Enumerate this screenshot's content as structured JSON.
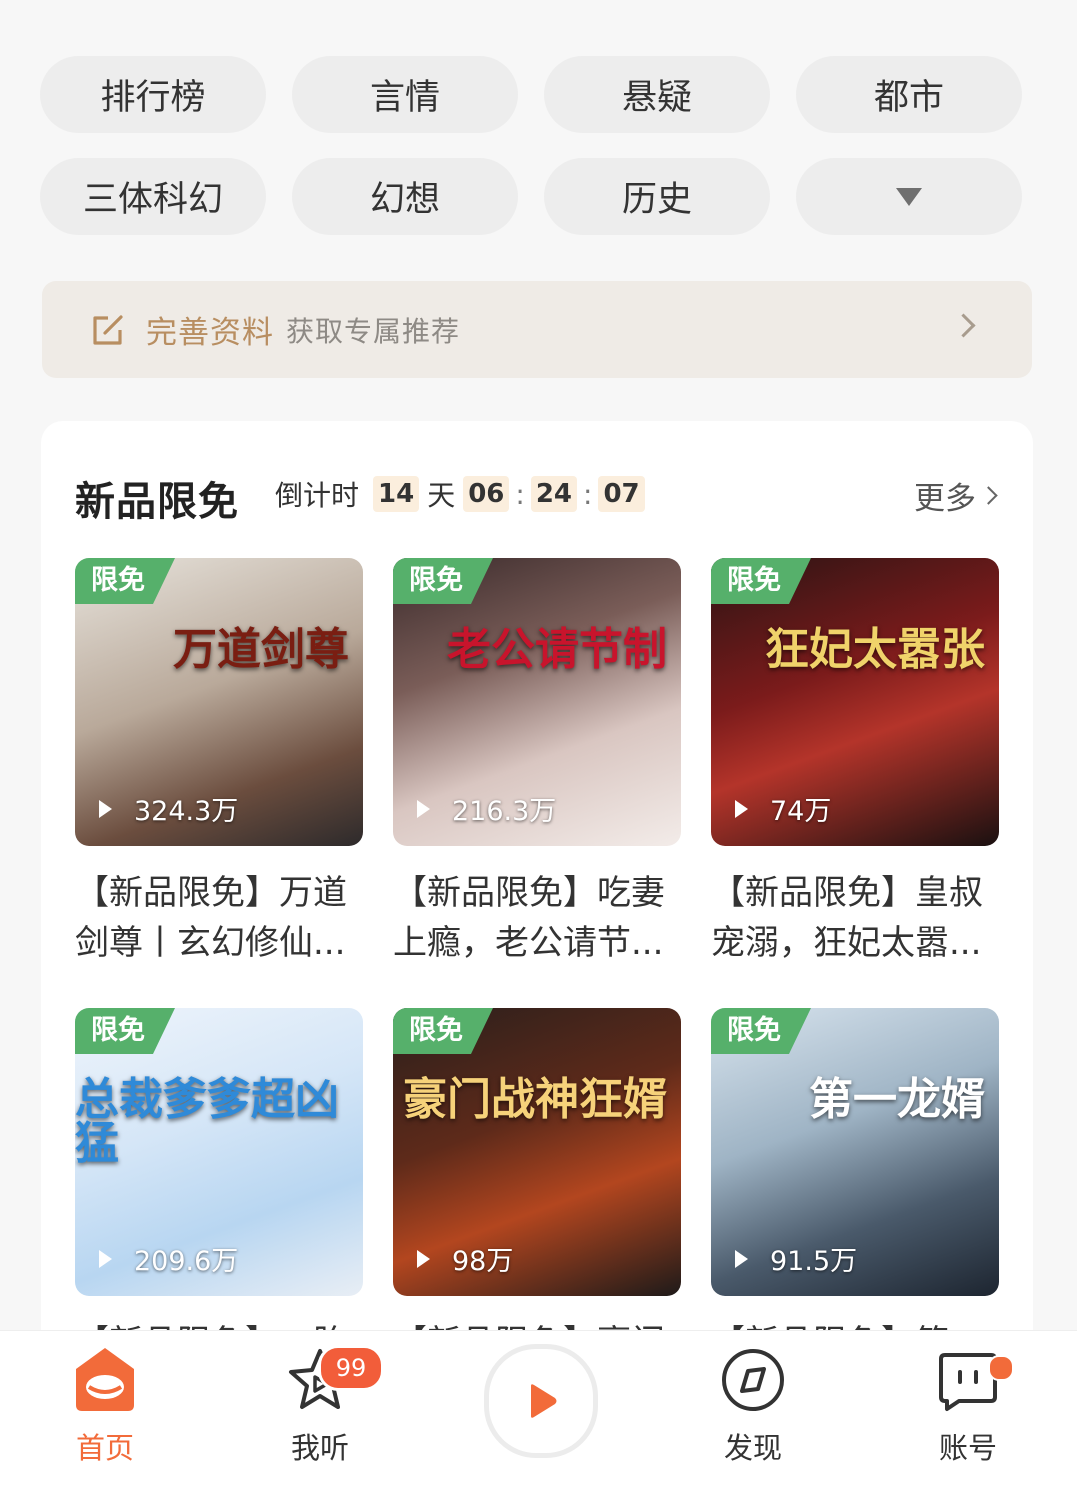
{
  "categories": [
    {
      "label": "排行榜"
    },
    {
      "label": "言情"
    },
    {
      "label": "悬疑"
    },
    {
      "label": "都市"
    },
    {
      "label": "三体科幻"
    },
    {
      "label": "幻想"
    },
    {
      "label": "历史"
    },
    {
      "label": ""
    }
  ],
  "profile_banner": {
    "icon": "edit-icon",
    "highlight": "完善资料",
    "text": "获取专属推荐",
    "icon_color": "#b88e61"
  },
  "section": {
    "title": "新品限免",
    "countdown": {
      "label": "倒计时",
      "days": "14",
      "day_unit": "天",
      "hours": "06",
      "minutes": "24",
      "seconds": "07"
    },
    "more_label": "更多"
  },
  "books": [
    {
      "tag": "限免",
      "plays": "324.3万",
      "cover_text": "万道剑尊",
      "line1": "【新品限免】万道",
      "line2": "剑尊丨玄幻修仙...",
      "bg": "linear-gradient(160deg,#e7e3dc 0%,#b9a99a 45%,#6b4d3e 75%,#2d2a2b 100%)",
      "text_color": "#7a1e12"
    },
    {
      "tag": "限免",
      "plays": "216.3万",
      "cover_text": "老公请节制",
      "line1": "【新品限免】吃妻",
      "line2": "上瘾，老公请节...",
      "bg": "linear-gradient(160deg,#3a2a2b 0%,#7a5d58 35%,#d9c6c1 65%,#f3ece9 100%)",
      "text_color": "#c8142c"
    },
    {
      "tag": "限免",
      "plays": "74万",
      "cover_text": "狂妃太嚣张",
      "line1": "【新品限免】皇叔",
      "line2": "宠溺，狂妃太嚣...",
      "bg": "linear-gradient(160deg,#2b1414 0%,#7b1b1b 40%,#b4342a 60%,#1a1010 100%)",
      "text_color": "#f0d36a"
    },
    {
      "tag": "限免",
      "plays": "209.6万",
      "cover_text": "总裁爹爹超凶猛",
      "line1": "【新品限免】一胎",
      "line2": "",
      "bg": "linear-gradient(160deg,#eef4fb 0%,#d5e6f7 40%,#b8d6f1 70%,#e8eef5 100%)",
      "text_color": "#2f8ad8"
    },
    {
      "tag": "限免",
      "plays": "98万",
      "cover_text": "豪门战神狂婿",
      "line1": "【新品限免】豪门",
      "line2": "",
      "bg": "linear-gradient(160deg,#2a1f1c 0%,#5e2a1a 40%,#b3461f 65%,#1e1a19 100%)",
      "text_color": "#f6d27a"
    },
    {
      "tag": "限免",
      "plays": "91.5万",
      "cover_text": "第一龙婿",
      "line1": "【新品限免】第一",
      "line2": "",
      "bg": "linear-gradient(160deg,#d8e4ee 0%,#9fb4c5 40%,#4a5a6b 70%,#1d2530 100%)",
      "text_color": "#ffffff"
    }
  ],
  "nav": {
    "items": [
      {
        "label": "首页",
        "icon": "home-icon",
        "active": true
      },
      {
        "label": "我听",
        "icon": "star-play-icon",
        "badge": "99"
      },
      {
        "label": "",
        "icon": "play-icon"
      },
      {
        "label": "发现",
        "icon": "compass-icon"
      },
      {
        "label": "账号",
        "icon": "account-icon",
        "dot": true
      }
    ],
    "accent": "#f26b3a"
  }
}
